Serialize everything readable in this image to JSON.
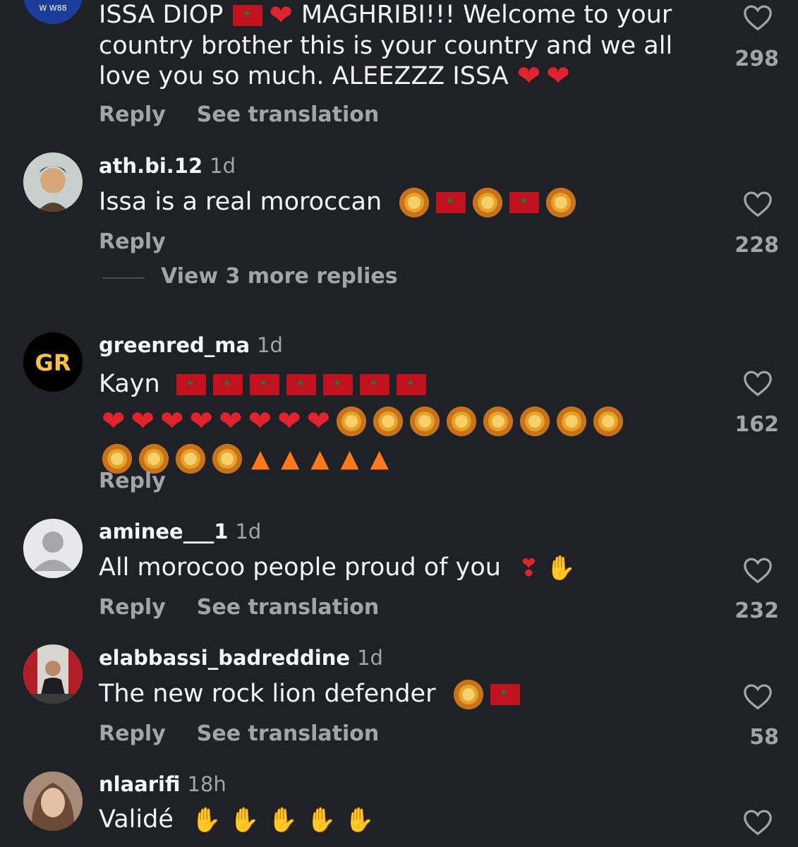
{
  "comments": [
    {
      "username": "",
      "time": "",
      "text_line1a": "ISSA DIOP",
      "text_line1b": "MAGHRIBI!!! Welcome to your",
      "text_line2": "country brother this is your country and we all",
      "text_line3": "love you so much. ALEEZZZ ISSA",
      "likes": "298",
      "actions": [
        "Reply",
        "See translation"
      ],
      "avatar_text": "W W88"
    },
    {
      "username": "ath.bi.12",
      "time": "1d",
      "text": "Issa is a real moroccan",
      "likes": "228",
      "actions": [
        "Reply"
      ],
      "view_more": "View 3 more replies"
    },
    {
      "username": "greenred_ma",
      "time": "1d",
      "text": "Kayn",
      "likes": "162",
      "actions": [
        "Reply"
      ],
      "avatar_text": "GR"
    },
    {
      "username": "aminee___1",
      "time": "1d",
      "text": "All morocoo people proud of you",
      "likes": "232",
      "actions": [
        "Reply",
        "See translation"
      ]
    },
    {
      "username": "elabbassi_badreddine",
      "time": "1d",
      "text": "The new rock lion defender",
      "likes": "58",
      "actions": [
        "Reply",
        "See translation"
      ]
    },
    {
      "username": "nlaarifi",
      "time": "18h",
      "text": "Validé",
      "likes": "",
      "actions": []
    }
  ],
  "icons": {
    "heart": "heart-outline-icon",
    "flag": "morocco-flag-icon",
    "lion": "lion-face-icon",
    "red_heart": "red-heart-icon",
    "fire": "fire-icon",
    "clap": "clapping-hands-icon"
  },
  "colors": {
    "background": "#202126",
    "text": "#f5f5f5",
    "muted": "#a3a4a8"
  }
}
